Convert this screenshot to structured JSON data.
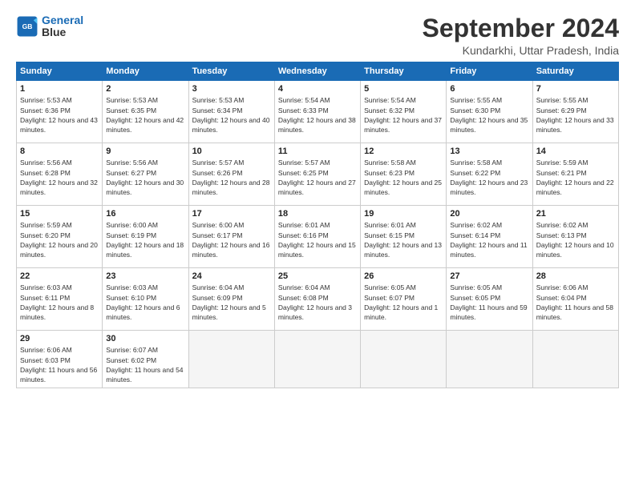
{
  "logo": {
    "line1": "General",
    "line2": "Blue"
  },
  "title": "September 2024",
  "subtitle": "Kundarkhi, Uttar Pradesh, India",
  "weekdays": [
    "Sunday",
    "Monday",
    "Tuesday",
    "Wednesday",
    "Thursday",
    "Friday",
    "Saturday"
  ],
  "weeks": [
    [
      {
        "day": 1,
        "sunrise": "5:53 AM",
        "sunset": "6:36 PM",
        "daylight": "12 hours and 43 minutes."
      },
      {
        "day": 2,
        "sunrise": "5:53 AM",
        "sunset": "6:35 PM",
        "daylight": "12 hours and 42 minutes."
      },
      {
        "day": 3,
        "sunrise": "5:53 AM",
        "sunset": "6:34 PM",
        "daylight": "12 hours and 40 minutes."
      },
      {
        "day": 4,
        "sunrise": "5:54 AM",
        "sunset": "6:33 PM",
        "daylight": "12 hours and 38 minutes."
      },
      {
        "day": 5,
        "sunrise": "5:54 AM",
        "sunset": "6:32 PM",
        "daylight": "12 hours and 37 minutes."
      },
      {
        "day": 6,
        "sunrise": "5:55 AM",
        "sunset": "6:30 PM",
        "daylight": "12 hours and 35 minutes."
      },
      {
        "day": 7,
        "sunrise": "5:55 AM",
        "sunset": "6:29 PM",
        "daylight": "12 hours and 33 minutes."
      }
    ],
    [
      {
        "day": 8,
        "sunrise": "5:56 AM",
        "sunset": "6:28 PM",
        "daylight": "12 hours and 32 minutes."
      },
      {
        "day": 9,
        "sunrise": "5:56 AM",
        "sunset": "6:27 PM",
        "daylight": "12 hours and 30 minutes."
      },
      {
        "day": 10,
        "sunrise": "5:57 AM",
        "sunset": "6:26 PM",
        "daylight": "12 hours and 28 minutes."
      },
      {
        "day": 11,
        "sunrise": "5:57 AM",
        "sunset": "6:25 PM",
        "daylight": "12 hours and 27 minutes."
      },
      {
        "day": 12,
        "sunrise": "5:58 AM",
        "sunset": "6:23 PM",
        "daylight": "12 hours and 25 minutes."
      },
      {
        "day": 13,
        "sunrise": "5:58 AM",
        "sunset": "6:22 PM",
        "daylight": "12 hours and 23 minutes."
      },
      {
        "day": 14,
        "sunrise": "5:59 AM",
        "sunset": "6:21 PM",
        "daylight": "12 hours and 22 minutes."
      }
    ],
    [
      {
        "day": 15,
        "sunrise": "5:59 AM",
        "sunset": "6:20 PM",
        "daylight": "12 hours and 20 minutes."
      },
      {
        "day": 16,
        "sunrise": "6:00 AM",
        "sunset": "6:19 PM",
        "daylight": "12 hours and 18 minutes."
      },
      {
        "day": 17,
        "sunrise": "6:00 AM",
        "sunset": "6:17 PM",
        "daylight": "12 hours and 16 minutes."
      },
      {
        "day": 18,
        "sunrise": "6:01 AM",
        "sunset": "6:16 PM",
        "daylight": "12 hours and 15 minutes."
      },
      {
        "day": 19,
        "sunrise": "6:01 AM",
        "sunset": "6:15 PM",
        "daylight": "12 hours and 13 minutes."
      },
      {
        "day": 20,
        "sunrise": "6:02 AM",
        "sunset": "6:14 PM",
        "daylight": "12 hours and 11 minutes."
      },
      {
        "day": 21,
        "sunrise": "6:02 AM",
        "sunset": "6:13 PM",
        "daylight": "12 hours and 10 minutes."
      }
    ],
    [
      {
        "day": 22,
        "sunrise": "6:03 AM",
        "sunset": "6:11 PM",
        "daylight": "12 hours and 8 minutes."
      },
      {
        "day": 23,
        "sunrise": "6:03 AM",
        "sunset": "6:10 PM",
        "daylight": "12 hours and 6 minutes."
      },
      {
        "day": 24,
        "sunrise": "6:04 AM",
        "sunset": "6:09 PM",
        "daylight": "12 hours and 5 minutes."
      },
      {
        "day": 25,
        "sunrise": "6:04 AM",
        "sunset": "6:08 PM",
        "daylight": "12 hours and 3 minutes."
      },
      {
        "day": 26,
        "sunrise": "6:05 AM",
        "sunset": "6:07 PM",
        "daylight": "12 hours and 1 minute."
      },
      {
        "day": 27,
        "sunrise": "6:05 AM",
        "sunset": "6:05 PM",
        "daylight": "11 hours and 59 minutes."
      },
      {
        "day": 28,
        "sunrise": "6:06 AM",
        "sunset": "6:04 PM",
        "daylight": "11 hours and 58 minutes."
      }
    ],
    [
      {
        "day": 29,
        "sunrise": "6:06 AM",
        "sunset": "6:03 PM",
        "daylight": "11 hours and 56 minutes."
      },
      {
        "day": 30,
        "sunrise": "6:07 AM",
        "sunset": "6:02 PM",
        "daylight": "11 hours and 54 minutes."
      },
      null,
      null,
      null,
      null,
      null
    ]
  ]
}
